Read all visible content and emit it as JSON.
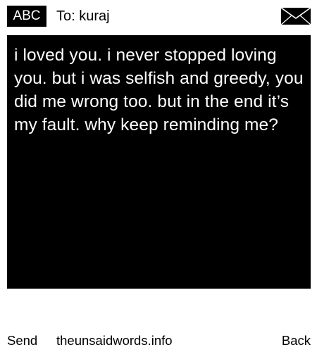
{
  "header": {
    "mode_badge": "ABC",
    "recipient": "To: kuraj",
    "icon": "envelope-icon"
  },
  "message": {
    "body": "i loved you. i never stopped loving you. but i was selfish and greedy, you did me wrong too. but in the end it’s my fault. why keep reminding me?"
  },
  "footer": {
    "send_label": "Send",
    "site_label": "theunsaidwords.info",
    "back_label": "Back"
  },
  "colors": {
    "panel": "#000000",
    "text_on_panel": "#ffffff",
    "background": "#ffffff"
  }
}
